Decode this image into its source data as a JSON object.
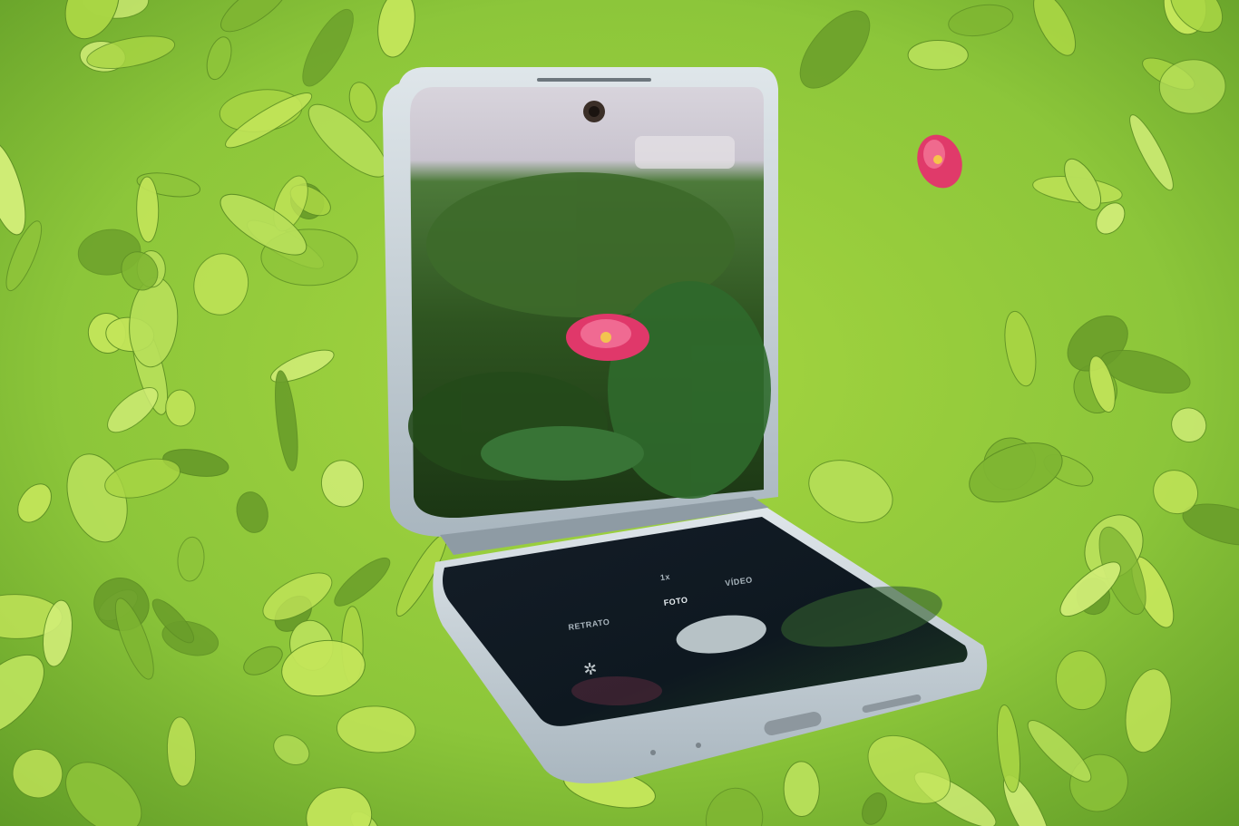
{
  "camera_ui": {
    "modes": [
      "RETRATO",
      "FOTO",
      "VÍDEO"
    ],
    "selected_mode": "FOTO",
    "zoom": "1x"
  },
  "colors": {
    "foliage_light": "#b4dc4a",
    "foliage_mid": "#8cc63a",
    "foliage_dark": "#2f5a18",
    "phone_frame": "#b9c4cc",
    "screen_dark": "#101a22",
    "flower_pink": "#e03a6a"
  }
}
